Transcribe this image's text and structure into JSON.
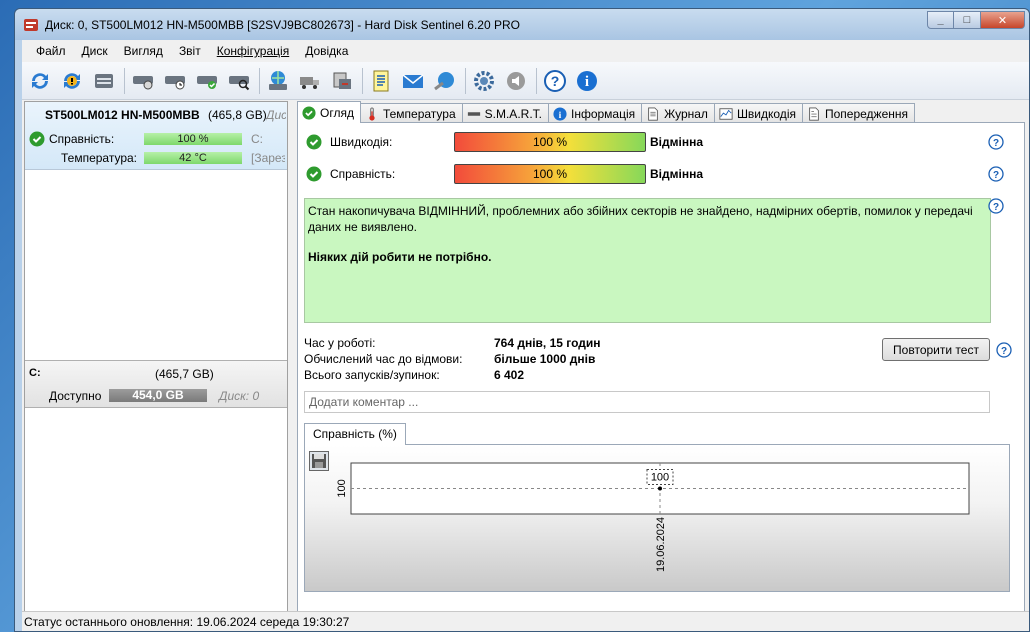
{
  "window": {
    "title": "Диск: 0, ST500LM012 HN-M500MBB [S2SVJ9BC802673]  -  Hard Disk Sentinel 6.20 PRO",
    "minimize": "_",
    "maximize": "□",
    "close": "✕"
  },
  "menu": [
    "Файл",
    "Диск",
    "Вигляд",
    "Звіт",
    "Конфігурація",
    "Довідка"
  ],
  "toolbar": {
    "icons": [
      "refresh-icon",
      "refresh-warning-icon",
      "disk-icon",
      "disk-check-icon",
      "disk-clock-icon",
      "disk-ok-icon",
      "disk-search-icon",
      "globe-disk-icon",
      "truck-icon",
      "backup-icon",
      "report-icon",
      "mail-icon",
      "send-icon",
      "gear-icon",
      "sound-icon",
      "help-icon",
      "info-icon"
    ]
  },
  "disk": {
    "name": "ST500LM012 HN-M500MBB",
    "size": "(465,8 GB)",
    "extra": "Дис",
    "health_label": "Справність:",
    "health_value": "100 %",
    "health_aux": "C:",
    "temp_label": "Температура:",
    "temp_value": "42 °C",
    "temp_aux": "[Зарезерв"
  },
  "volume": {
    "letter": "C:",
    "size": "(465,7 GB)",
    "available_label": "Доступно",
    "available_value": "454,0 GB",
    "disk_ref": "Диск: 0",
    "free_fraction": 0.975
  },
  "tabs": [
    "Огляд",
    "Температура",
    "S.M.A.R.T.",
    "Інформація",
    "Журнал",
    "Швидкодія",
    "Попередження"
  ],
  "overview": {
    "performance_label": "Швидкодія:",
    "performance_value": "100 %",
    "performance_rating": "Відмінна",
    "health_label": "Справність:",
    "health_value": "100 %",
    "health_rating": "Відмінна",
    "status_text": "Стан накопичувача ВІДМІННИЙ, проблемних або збійних секторів не знайдено, надмірних обертів, помилок у передачі даних не виявлено.",
    "status_action": "Ніяких дій робити не потрібно.",
    "uptime_label": "Час у роботі:",
    "uptime_value": "764 днів, 15 годин",
    "estimated_label": "Обчислений час до відмови:",
    "estimated_value": "більше 1000 днів",
    "starts_label": "Всього запусків/зупинок:",
    "starts_value": "6 402",
    "retest_button": "Повторити тест",
    "comment_placeholder": "Додати коментар ..."
  },
  "chart_tab": "Справність (%)",
  "chart_data": {
    "type": "line",
    "x": [
      "19.06.2024"
    ],
    "series": [
      {
        "values": [
          100
        ]
      }
    ],
    "ylabel": "",
    "xlabel": "",
    "y_tick": "100",
    "point_label": "100",
    "grid": true
  },
  "status_bar": "Статус останнього оновлення: 19.06.2024 середа 19:30:27"
}
